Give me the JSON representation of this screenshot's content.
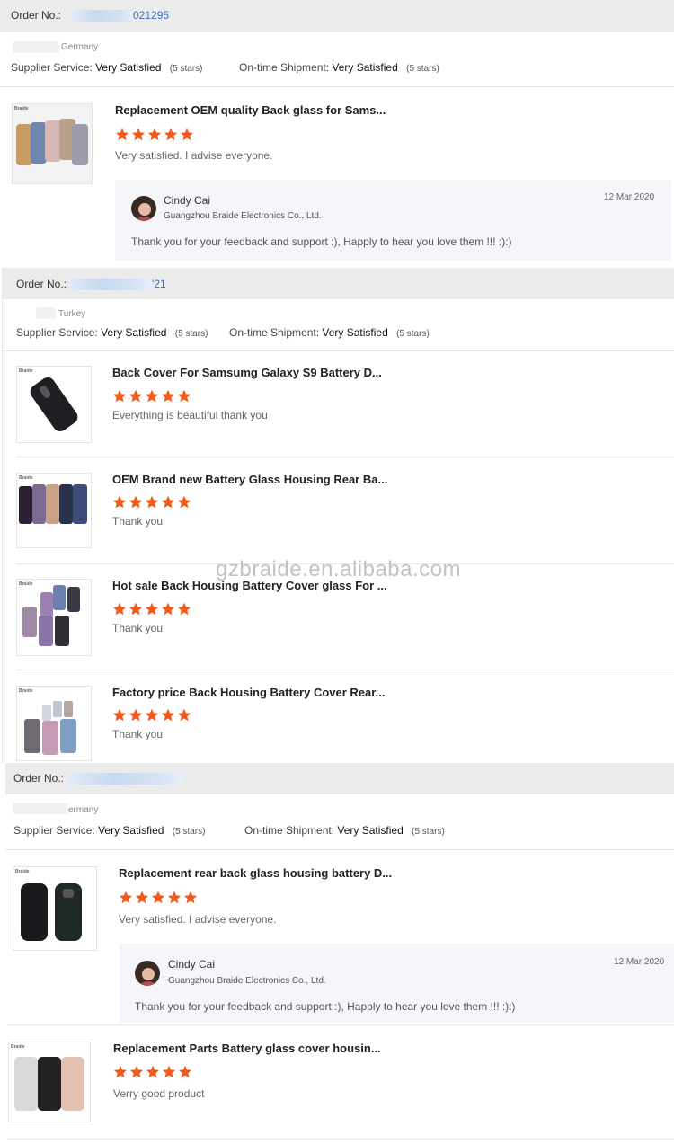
{
  "colors": {
    "star": "#f05a1a",
    "order_link": "#3d6cc5",
    "bar": "#ebebeb",
    "reply_bg": "#f4f6fa"
  },
  "watermark": "gzbraide.en.alibaba.com",
  "orders": [
    {
      "order_label": "Order No.:",
      "order_number": "021295",
      "country": "Germany",
      "supplier_service_label": "Supplier Service:",
      "supplier_service_value": "Very Satisfied",
      "supplier_service_stars": "(5 stars)",
      "shipment_label": "On-time Shipment:",
      "shipment_value": "Very Satisfied",
      "shipment_stars": "(5 stars)",
      "reviews": [
        {
          "title": "Replacement OEM quality Back glass for Sams...",
          "rating": 5,
          "text": "Very satisfied. I advise everyone.",
          "thumb_brand": "Braide",
          "reply": {
            "name": "Cindy Cai",
            "company": "Guangzhou Braide Electronics Co., Ltd.",
            "date": "12 Mar 2020",
            "message": "Thank you for your feedback and support :), Happly to hear you love them !!!  :):)"
          }
        }
      ]
    },
    {
      "order_label": "Order No.:",
      "order_number": "'21",
      "country": "Turkey",
      "supplier_service_label": "Supplier Service:",
      "supplier_service_value": "Very Satisfied",
      "supplier_service_stars": "(5 stars)",
      "shipment_label": "On-time Shipment:",
      "shipment_value": "Very Satisfied",
      "shipment_stars": "(5 stars)",
      "reviews": [
        {
          "title": "Back Cover For Samsumg Galaxy S9 Battery D...",
          "rating": 5,
          "text": "Everything is beautiful thank you",
          "thumb_brand": "Braide"
        },
        {
          "title": "OEM Brand new Battery Glass Housing Rear Ba...",
          "rating": 5,
          "text": "Thank you",
          "thumb_brand": "Braide"
        },
        {
          "title": "Hot sale Back Housing Battery Cover glass For ...",
          "rating": 5,
          "text": "Thank you",
          "thumb_brand": "Braide"
        },
        {
          "title": "Factory price Back Housing Battery Cover Rear...",
          "rating": 5,
          "text": "Thank you",
          "thumb_brand": "Braide"
        }
      ]
    },
    {
      "order_label": "Order No.:",
      "order_number": "",
      "country": "ermany",
      "supplier_service_label": "Supplier Service:",
      "supplier_service_value": "Very Satisfied",
      "supplier_service_stars": "(5 stars)",
      "shipment_label": "On-time Shipment:",
      "shipment_value": "Very Satisfied",
      "shipment_stars": "(5 stars)",
      "reviews": [
        {
          "title": "Replacement rear back glass housing battery D...",
          "rating": 5,
          "text": "Very satisfied. I advise everyone.",
          "thumb_brand": "Braide",
          "reply": {
            "name": "Cindy Cai",
            "company": "Guangzhou Braide Electronics Co., Ltd.",
            "date": "12 Mar 2020",
            "message": "Thank you for your feedback and support :), Happly to hear you love them !!!  :):)"
          }
        },
        {
          "title": "Replacement Parts Battery glass cover housin...",
          "rating": 5,
          "text": "Verry good product",
          "thumb_brand": "Braide"
        }
      ]
    }
  ]
}
